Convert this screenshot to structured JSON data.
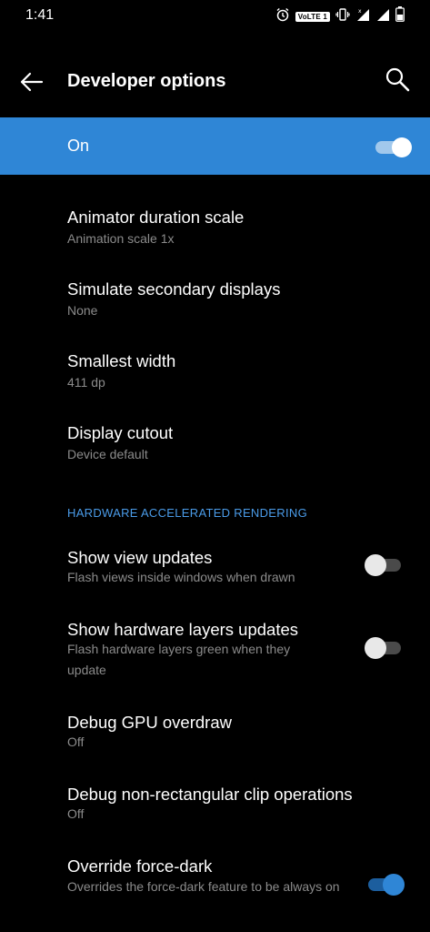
{
  "status_bar": {
    "time": "1:41",
    "network_badge": "VoLTE 1",
    "icons": [
      "alarm-icon",
      "volte-icon",
      "vibrate-icon",
      "signal-icon",
      "signal-icon",
      "battery-icon"
    ]
  },
  "app_bar": {
    "title": "Developer options",
    "back_icon": "arrow-left-icon",
    "search_icon": "search-icon"
  },
  "master_switch": {
    "label": "On",
    "enabled": true,
    "color": "#2f86d6"
  },
  "items": [
    {
      "title": "Animator duration scale",
      "summary": "Animation scale 1x"
    },
    {
      "title": "Simulate secondary displays",
      "summary": "None"
    },
    {
      "title": "Smallest width",
      "summary": "411 dp"
    },
    {
      "title": "Display cutout",
      "summary": "Device default"
    }
  ],
  "section": {
    "header": "HARDWARE ACCELERATED RENDERING"
  },
  "hw_items": [
    {
      "title": "Show view updates",
      "summary": "Flash views inside windows when drawn",
      "toggle": false
    },
    {
      "title": "Show hardware layers updates",
      "summary": "Flash hardware layers green when they update",
      "toggle": false
    },
    {
      "title": "Debug GPU overdraw",
      "summary": "Off"
    },
    {
      "title": "Debug non-rectangular clip operations",
      "summary": "Off"
    },
    {
      "title": "Override force-dark",
      "summary": "Overrides the force-dark feature to be always on",
      "toggle": true
    }
  ],
  "colors": {
    "accent": "#2f86d6",
    "section_header": "#4a9be8",
    "summary": "#8b8b8b",
    "background": "#000000"
  }
}
